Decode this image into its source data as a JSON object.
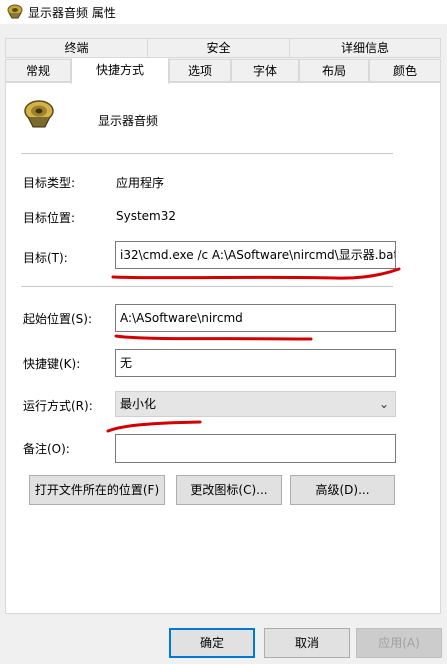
{
  "window": {
    "title": "显示器音频 属性"
  },
  "tabs_row1": [
    "终端",
    "安全",
    "详细信息"
  ],
  "tabs_row2": [
    "常规",
    "快捷方式",
    "选项",
    "字体",
    "布局",
    "颜色"
  ],
  "shortcut": {
    "name": "显示器音频",
    "target_type_label": "目标类型:",
    "target_type_value": "应用程序",
    "target_location_label": "目标位置:",
    "target_location_value": "System32",
    "target_label": "目标(T):",
    "target_value": "i32\\cmd.exe /c A:\\ASoftware\\nircmd\\显示器.bat",
    "start_in_label": "起始位置(S):",
    "start_in_value": "A:\\ASoftware\\nircmd",
    "hotkey_label": "快捷键(K):",
    "hotkey_value": "无",
    "run_label": "运行方式(R):",
    "run_value": "最小化",
    "comment_label": "备注(O):",
    "comment_value": ""
  },
  "buttons": {
    "open_location": "打开文件所在的位置(F)",
    "change_icon": "更改图标(C)...",
    "advanced": "高级(D)...",
    "ok": "确定",
    "cancel": "取消",
    "apply": "应用(A)"
  },
  "colors": {
    "annotation": "#d40000",
    "accent": "#0078d7"
  }
}
